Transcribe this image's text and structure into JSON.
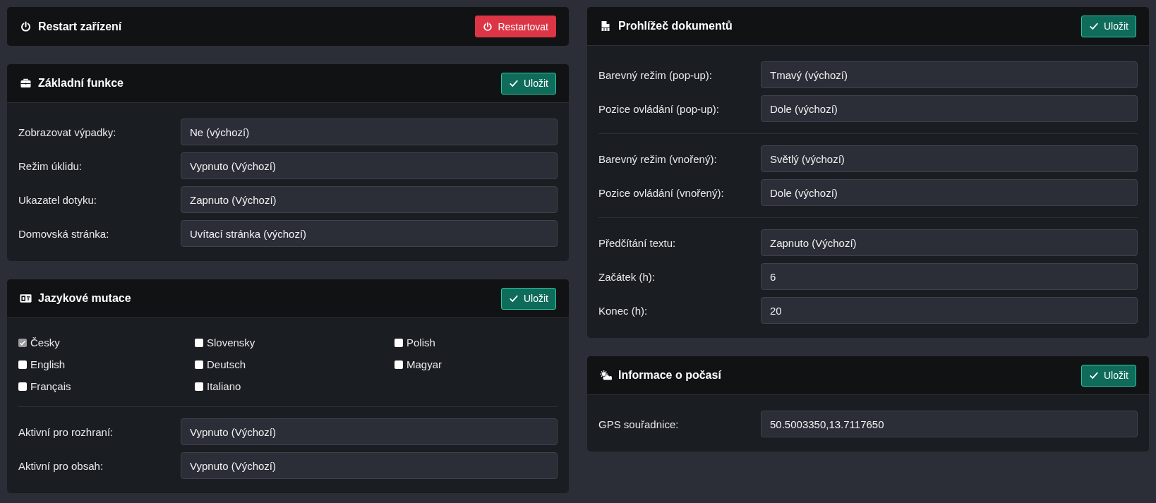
{
  "restart_card": {
    "title": "Restart zařízení",
    "button": "Restartovat"
  },
  "basic_card": {
    "title": "Základní funkce",
    "save": "Uložit",
    "rows": [
      {
        "label": "Zobrazovat výpadky:",
        "value": "Ne (výchozí)"
      },
      {
        "label": "Režim úklidu:",
        "value": "Vypnuto (Výchozí)"
      },
      {
        "label": "Ukazatel dotyku:",
        "value": "Zapnuto (Výchozí)"
      },
      {
        "label": "Domovská stránka:",
        "value": "Uvítací stránka (výchozí)"
      }
    ]
  },
  "languages_card": {
    "title": "Jazykové mutace",
    "save": "Uložit",
    "languages": [
      {
        "label": "Česky",
        "checked": true,
        "disabled": true
      },
      {
        "label": "Slovensky",
        "checked": false,
        "disabled": false
      },
      {
        "label": "Polish",
        "checked": false,
        "disabled": false
      },
      {
        "label": "English",
        "checked": false,
        "disabled": false
      },
      {
        "label": "Deutsch",
        "checked": false,
        "disabled": false
      },
      {
        "label": "Magyar",
        "checked": false,
        "disabled": false
      },
      {
        "label": "Français",
        "checked": false,
        "disabled": false
      },
      {
        "label": "Italiano",
        "checked": false,
        "disabled": false
      }
    ],
    "rows": [
      {
        "label": "Aktivní pro rozhraní:",
        "value": "Vypnuto (Výchozí)"
      },
      {
        "label": "Aktivní pro obsah:",
        "value": "Vypnuto (Výchozí)"
      }
    ]
  },
  "viewer_card": {
    "title": "Prohlížeč dokumentů",
    "save": "Uložit",
    "groups": [
      [
        {
          "label": "Barevný režim (pop-up):",
          "value": "Tmavý (výchozí)"
        },
        {
          "label": "Pozice ovládání (pop-up):",
          "value": "Dole (výchozí)"
        }
      ],
      [
        {
          "label": "Barevný režim (vnořený):",
          "value": "Světlý (výchozí)"
        },
        {
          "label": "Pozice ovládání (vnořený):",
          "value": "Dole (výchozí)"
        }
      ],
      [
        {
          "label": "Předčítání textu:",
          "value": "Zapnuto (Výchozí)"
        },
        {
          "label": "Začátek (h):",
          "value": "6"
        },
        {
          "label": "Konec (h):",
          "value": "20"
        }
      ]
    ]
  },
  "weather_card": {
    "title": "Informace o počasí",
    "save": "Uložit",
    "rows": [
      {
        "label": "GPS souřadnice:",
        "value": "50.5003350,13.7117650"
      }
    ]
  }
}
